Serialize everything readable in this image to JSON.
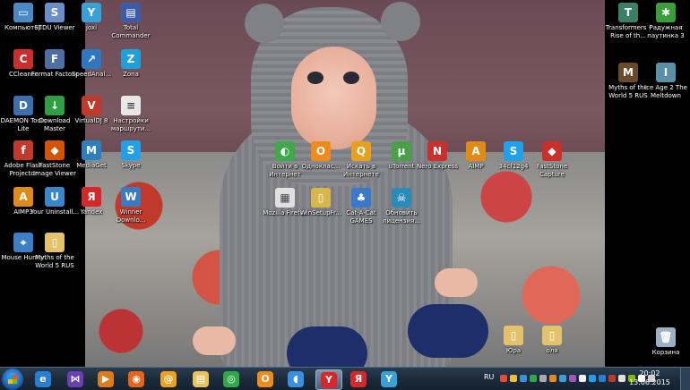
{
  "desktop": {
    "left_icons": [
      {
        "label": "Компьютер",
        "icon": "computer-icon",
        "color": "#4a88c6",
        "glyph": "▭"
      },
      {
        "label": "STDU Viewer",
        "icon": "stdu-viewer-icon",
        "color": "#6a8fc8",
        "glyph": "S"
      },
      {
        "label": "joxi",
        "icon": "joxi-icon",
        "color": "#3aa0d8",
        "glyph": "Y"
      },
      {
        "label": "Total Commander",
        "icon": "total-commander-icon",
        "color": "#3c5ca8",
        "glyph": "▤"
      },
      {
        "label": "CCleaner",
        "icon": "ccleaner-icon",
        "color": "#c9302c",
        "glyph": "C"
      },
      {
        "label": "Format Factory",
        "icon": "format-factory-icon",
        "color": "#4d6fa3",
        "glyph": "F"
      },
      {
        "label": "SpeedAnal...",
        "icon": "speedanalyzer-icon",
        "color": "#2e78c2",
        "glyph": "↗"
      },
      {
        "label": "Zona",
        "icon": "zona-icon",
        "color": "#1fa0d8",
        "glyph": "Z"
      },
      {
        "label": "DAEMON Tools Lite",
        "icon": "daemon-tools-icon",
        "color": "#3d6fb0",
        "glyph": "D"
      },
      {
        "label": "Download Master",
        "icon": "download-master-icon",
        "color": "#2f9e44",
        "glyph": "↓"
      },
      {
        "label": "VirtualDJ 8",
        "icon": "virtualdj-icon",
        "color": "#c0392b",
        "glyph": "V"
      },
      {
        "label": "Настройки маршрути...",
        "icon": "document-icon",
        "color": "#e8e8e8",
        "glyph": "≡"
      },
      {
        "label": "Adobe Flash Projector",
        "icon": "flash-icon",
        "color": "#c0392b",
        "glyph": "f"
      },
      {
        "label": "FastStone Image Viewer",
        "icon": "faststone-icon",
        "color": "#d35400",
        "glyph": "◆"
      },
      {
        "label": "MediaGet",
        "icon": "mediaget-icon",
        "color": "#2a7fc0",
        "glyph": "M"
      },
      {
        "label": "Skype",
        "icon": "skype-icon",
        "color": "#1fa0e8",
        "glyph": "S"
      },
      {
        "label": "AIMP3",
        "icon": "aimp-icon",
        "color": "#e08a1a",
        "glyph": "A"
      },
      {
        "label": "Your Uninstall...",
        "icon": "uninstall-icon",
        "color": "#3a86c8",
        "glyph": "U"
      },
      {
        "label": "Yandex",
        "icon": "yandex-icon",
        "color": "#d62828",
        "glyph": "Я"
      },
      {
        "label": "Winner Downlo...",
        "icon": "winner-icon",
        "color": "#3a7ac0",
        "glyph": "W"
      },
      {
        "label": "Mouse Hunter",
        "icon": "mouse-hunter-icon",
        "color": "#3d7fc4",
        "glyph": "⌖"
      },
      {
        "label": "Myths of the World 5 RUS",
        "icon": "folder-icon",
        "color": "#e2c26a",
        "glyph": "▯"
      }
    ],
    "right_icons": [
      {
        "label": "Transformers - Rise of th...",
        "icon": "transformers-icon",
        "color": "#3a7f6a",
        "glyph": "T"
      },
      {
        "label": "Радужная паутинка 3",
        "icon": "spider-game-icon",
        "color": "#3a9e3a",
        "glyph": "✱"
      },
      {
        "label": "Myths of the World 5 RUS",
        "icon": "myths-game-icon",
        "color": "#6a4a2a",
        "glyph": "M"
      },
      {
        "label": "Ice Age 2 The Meltdown",
        "icon": "ice-age-icon",
        "color": "#5a8fa8",
        "glyph": "I"
      }
    ],
    "center_icons": [
      {
        "label": "Войти в Интернет",
        "icon": "internet-icon",
        "color": "#3fa84a",
        "glyph": "◐"
      },
      {
        "label": "Одноклас...",
        "icon": "odnoklassniki-icon",
        "color": "#ef8a1d",
        "glyph": "О"
      },
      {
        "label": "Искать в Интернете",
        "icon": "search-web-icon",
        "color": "#e8a020",
        "glyph": "Q"
      },
      {
        "label": "uTorrent",
        "icon": "utorrent-icon",
        "color": "#4aa048",
        "glyph": "µ"
      },
      {
        "label": "Nero Express",
        "icon": "nero-icon",
        "color": "#c93030",
        "glyph": "N"
      },
      {
        "label": "AIMP",
        "icon": "aimp-icon",
        "color": "#e08a1a",
        "glyph": "A"
      },
      {
        "label": "34cf12g4",
        "icon": "skype-icon",
        "color": "#1fa0e8",
        "glyph": "S"
      },
      {
        "label": "FastStone Capture",
        "icon": "faststone-capture-icon",
        "color": "#c9302c",
        "glyph": "◆"
      },
      {
        "label": "Mozilla Firefox",
        "icon": "firefox-icon",
        "color": "#e0e0e0",
        "glyph": "▦"
      },
      {
        "label": "WinSetupFr...",
        "icon": "winsetup-icon",
        "color": "#d9b64a",
        "glyph": "▯"
      },
      {
        "label": "Cat-A-Cat GAMES",
        "icon": "catacat-icon",
        "color": "#3a78c8",
        "glyph": "♣"
      },
      {
        "label": "Обновить лицензия...",
        "icon": "update-license-icon",
        "color": "#2a8ab8",
        "glyph": "☠"
      }
    ],
    "bottom_icons": [
      {
        "label": "Юра",
        "icon": "folder-icon",
        "color": "#e2c26a",
        "glyph": "▯"
      },
      {
        "label": "оля",
        "icon": "folder-icon",
        "color": "#e2c26a",
        "glyph": "▯"
      },
      {
        "label": "Корзина",
        "icon": "recycle-bin-icon",
        "color": "#9ab0c4",
        "glyph": "🗑"
      }
    ]
  },
  "taskbar": {
    "apps": [
      {
        "icon": "internet-explorer-icon",
        "color": "#2a7fd4",
        "glyph": "e",
        "active": false
      },
      {
        "icon": "visual-studio-icon",
        "color": "#6a3fb0",
        "glyph": "⋈",
        "active": false
      },
      {
        "icon": "media-player-icon",
        "color": "#e07b1a",
        "glyph": "▶",
        "active": false
      },
      {
        "icon": "firefox-icon",
        "color": "#e8641a",
        "glyph": "◉",
        "active": false
      },
      {
        "icon": "mail-icon",
        "color": "#f0a020",
        "glyph": "@",
        "active": false
      },
      {
        "icon": "explorer-icon",
        "color": "#e8c35a",
        "glyph": "▤",
        "active": false
      },
      {
        "icon": "globe-icon",
        "color": "#2fa84a",
        "glyph": "◎",
        "active": false
      },
      {
        "icon": "odnoklassniki-icon",
        "color": "#ef8a1d",
        "glyph": "О",
        "active": false
      },
      {
        "icon": "volume-app-icon",
        "color": "#3a8fe0",
        "glyph": "◖",
        "active": false
      },
      {
        "icon": "yandex-browser-icon",
        "color": "#d62828",
        "glyph": "Y",
        "active": true
      },
      {
        "icon": "yandex-icon",
        "color": "#d62828",
        "glyph": "Я",
        "active": false
      },
      {
        "icon": "joxi-icon",
        "color": "#3aa0d8",
        "glyph": "Y",
        "active": false
      }
    ],
    "tray": {
      "language": "RU",
      "time": "20:02",
      "date": "13.06.2015",
      "icons": [
        "#e84a3a",
        "#f0c030",
        "#3a8fe0",
        "#2fa84a",
        "#aaa",
        "#e08a1a",
        "#3aa0d8",
        "#9b59b6",
        "#f2f2f2",
        "#1fa0e8",
        "#2a7fd4",
        "#c0392b",
        "#e0e0e0",
        "#7fba00",
        "#ffffff",
        "#d0d0d0"
      ]
    }
  }
}
